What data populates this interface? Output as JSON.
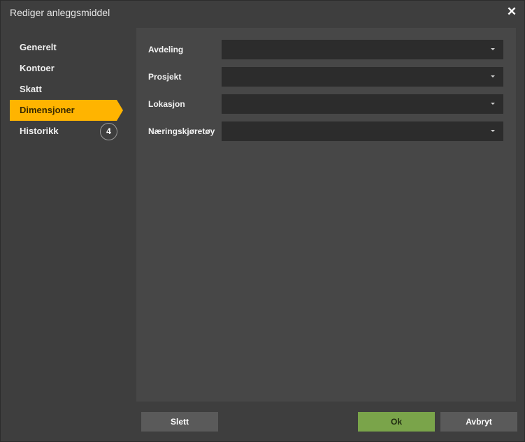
{
  "window": {
    "title": "Rediger anleggsmiddel",
    "close_symbol": "✕"
  },
  "sidebar": {
    "items": [
      {
        "label": "Generelt"
      },
      {
        "label": "Kontoer"
      },
      {
        "label": "Skatt"
      },
      {
        "label": "Dimensjoner",
        "active": true
      },
      {
        "label": "Historikk",
        "badge": "4"
      }
    ]
  },
  "fields": [
    {
      "label": "Avdeling",
      "value": ""
    },
    {
      "label": "Prosjekt",
      "value": ""
    },
    {
      "label": "Lokasjon",
      "value": ""
    },
    {
      "label": "Næringskjøretøy",
      "value": ""
    }
  ],
  "footer": {
    "delete_label": "Slett",
    "ok_label": "Ok",
    "cancel_label": "Avbryt"
  },
  "colors": {
    "accent": "#ffb400",
    "ok": "#7aa44a",
    "background": "#3e3e3e",
    "panel": "#474747",
    "input": "#2c2c2c"
  }
}
